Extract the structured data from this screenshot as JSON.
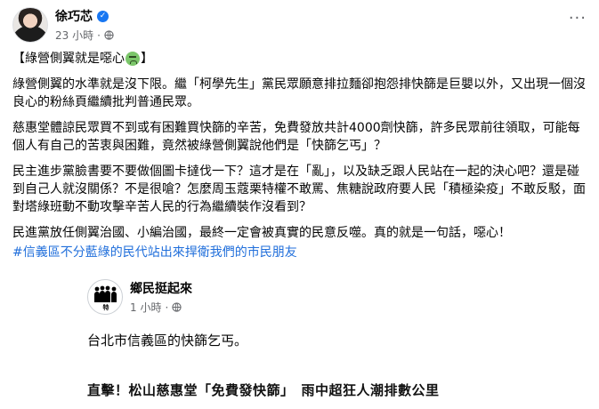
{
  "post": {
    "author": "徐巧芯",
    "time": "23 小時",
    "time_separator": "·",
    "more_icon": "more-options-icon",
    "paragraphs": {
      "title_before": "【綠營側翼就是噁心",
      "title_after": "】",
      "p1": "綠營側翼的水準就是沒下限。繼「柯學先生」黨民眾願意排拉麵卻抱怨排快篩是巨嬰以外，又出現一個沒良心的粉絲頁繼續批判普通民眾。",
      "p2": "慈惠堂體諒民眾買不到或有困難買快篩的辛苦，免費發放共計4000劑快篩，許多民眾前往領取，可能每個人有自己的苦衷與困難，竟然被綠營側翼說他們是「快篩乞丐」？",
      "p3": "民主進步黨臉書要不要做個圖卡撻伐一下？這才是在「亂」，以及缺乏跟人民站在一起的決心吧？還是碰到自己人就沒關係？不是很嗆？怎麼周玉蔻栗特權不敢罵、焦糖說政府要人民「積極染疫」不敢反駁，面對塔綠班動不動攻擊辛苦人民的行為繼續裝作沒看到？",
      "p4": "民進黨放任側翼治國、小編治國，最終一定會被真實的民意反噬。真的就是一句話，噁心！",
      "hashtag": "#信義區不分藍綠的民代站出來捍衛我們的市民朋友"
    }
  },
  "shared": {
    "page_name": "鄉民挺起來",
    "logo_tag": "特",
    "time": "1 小時",
    "time_separator": "·",
    "text": "台北市信義區的快篩乞丐。",
    "headline": "直擊！松山慈惠堂「免費發快篩」　雨中超狂人潮排數公里"
  },
  "colors": {
    "link": "#216fdb",
    "verified": "#1877f2",
    "secondary_text": "#65676b"
  }
}
